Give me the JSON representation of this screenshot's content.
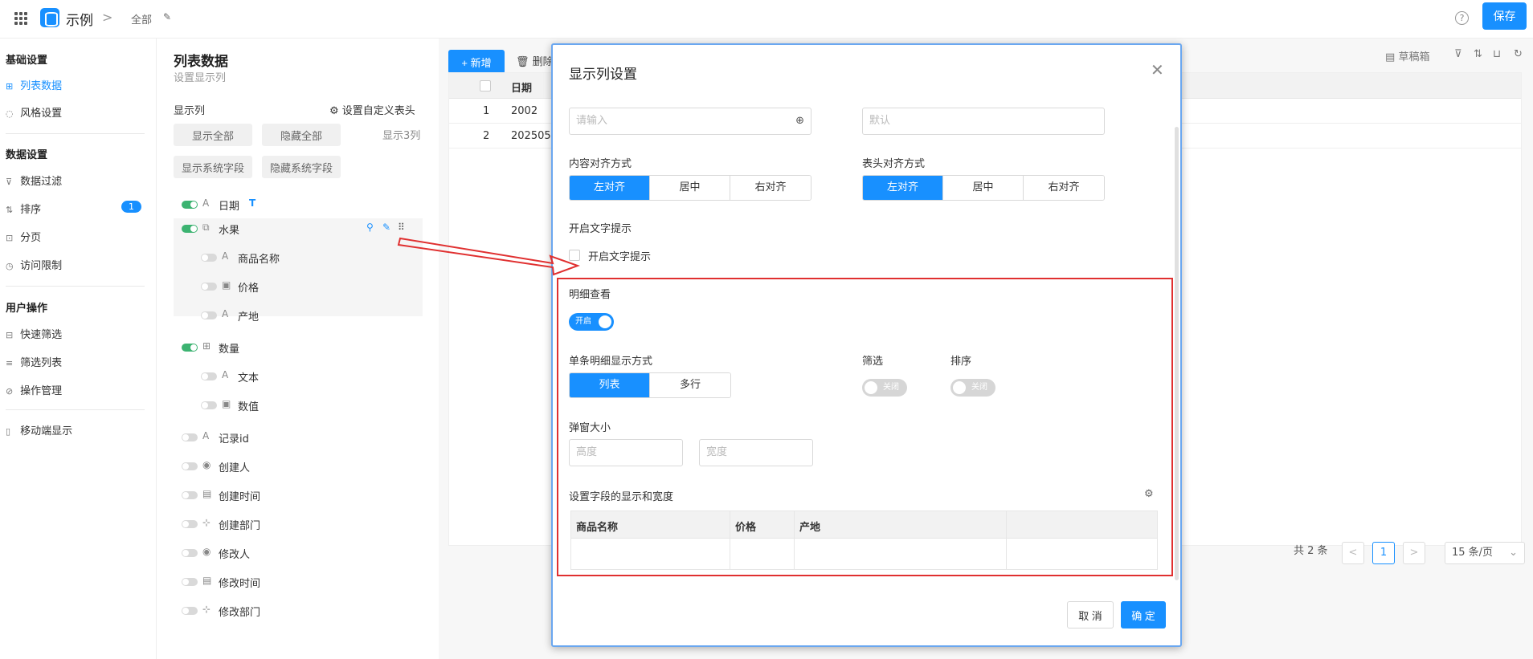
{
  "header": {
    "app_title": "示例",
    "breadcrumb": "全部",
    "help": "?",
    "save_label": "保存"
  },
  "sidebar": {
    "sections": [
      {
        "title": "基础设置",
        "items": [
          {
            "label": "列表数据",
            "active": true,
            "icon": "table-icon"
          },
          {
            "label": "风格设置",
            "icon": "palette-icon"
          }
        ]
      },
      {
        "title": "数据设置",
        "items": [
          {
            "label": "数据过滤",
            "icon": "filter-icon"
          },
          {
            "label": "排序",
            "icon": "sort-icon",
            "badge": "1"
          },
          {
            "label": "分页",
            "icon": "page-icon"
          },
          {
            "label": "访问限制",
            "icon": "lock-icon"
          }
        ]
      },
      {
        "title": "用户操作",
        "items": [
          {
            "label": "快速筛选",
            "icon": "quick-filter-icon"
          },
          {
            "label": "筛选列表",
            "icon": "list-icon"
          },
          {
            "label": "操作管理",
            "icon": "manage-icon"
          }
        ]
      },
      {
        "title": "",
        "items": [
          {
            "label": "移动端显示",
            "icon": "mobile-icon"
          }
        ]
      }
    ]
  },
  "columns_panel": {
    "title": "列表数据",
    "subtitle": "设置显示列",
    "show_label": "显示列",
    "custom_header": "设置自定义表头",
    "show_all": "显示全部",
    "hide_all": "隐藏全部",
    "show_sys": "显示系统字段",
    "hide_sys": "隐藏系统字段",
    "count": "显示3列",
    "fields": [
      {
        "name": "日期",
        "type": "A",
        "on": true,
        "tag": "T"
      },
      {
        "name": "水果",
        "type": "⧉",
        "on": true
      },
      {
        "name": "商品名称",
        "type": "A",
        "on": false,
        "sub": true
      },
      {
        "name": "价格",
        "type": "▣",
        "on": false,
        "sub": true
      },
      {
        "name": "产地",
        "type": "A",
        "on": false,
        "sub": true
      },
      {
        "name": "数量",
        "type": "⊞",
        "on": true
      },
      {
        "name": "文本",
        "type": "A",
        "on": false,
        "sub": true
      },
      {
        "name": "数值",
        "type": "▣",
        "on": false,
        "sub": true
      },
      {
        "name": "记录id",
        "type": "A",
        "on": false
      },
      {
        "name": "创建人",
        "type": "◉",
        "on": false
      },
      {
        "name": "创建时间",
        "type": "▤",
        "on": false
      },
      {
        "name": "创建部门",
        "type": "⊹",
        "on": false
      },
      {
        "name": "修改人",
        "type": "◉",
        "on": false
      },
      {
        "name": "修改时间",
        "type": "▤",
        "on": false
      },
      {
        "name": "修改部门",
        "type": "⊹",
        "on": false
      }
    ]
  },
  "main": {
    "add_label": "+ 新增",
    "del_label": "🗑 删除",
    "toolbar": {
      "draft": "草稿箱"
    },
    "table": {
      "header": "日期",
      "rows": [
        {
          "idx": "1",
          "date": "2002"
        },
        {
          "idx": "2",
          "date": "202505"
        }
      ]
    },
    "pager": {
      "total": "共 2 条",
      "page": "1",
      "size": "15 条/页"
    }
  },
  "modal": {
    "title": "显示列设置",
    "input_placeholder": "请输入",
    "default_placeholder": "默认",
    "content_align": "内容对齐方式",
    "header_align": "表头对齐方式",
    "align_opts": [
      "左对齐",
      "居中",
      "右对齐"
    ],
    "tooltip_title": "开启文字提示",
    "tooltip_check": "开启文字提示",
    "detail_title": "明细查看",
    "detail_switch": "开启",
    "single_mode": "单条明细显示方式",
    "mode_opts": [
      "列表",
      "多行"
    ],
    "filter_title": "筛选",
    "sort_title": "排序",
    "filter_switch": "关闭",
    "sort_switch": "关闭",
    "popup_size": "弹窗大小",
    "height_ph": "高度",
    "width_ph": "宽度",
    "fields_title": "设置字段的显示和宽度",
    "fields_cols": [
      "商品名称",
      "价格",
      "产地",
      ""
    ],
    "cancel": "取 消",
    "ok": "确 定"
  },
  "colors": {
    "accent": "#1890ff",
    "highlight": "#e03030",
    "toggle_on": "#3cb371"
  }
}
